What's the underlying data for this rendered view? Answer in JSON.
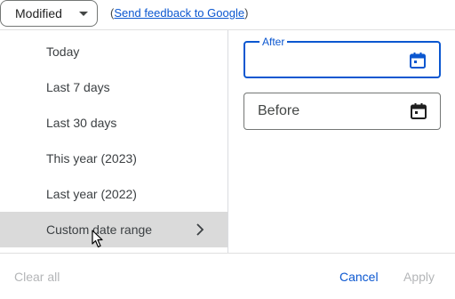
{
  "filter_chip": {
    "label": "Modified",
    "icon": "dropdown-caret-icon"
  },
  "feedback": {
    "open_paren": "(",
    "link_text": "Send feedback to Google",
    "close_paren": ")"
  },
  "menu": {
    "items": [
      {
        "label": "Today"
      },
      {
        "label": "Last 7 days"
      },
      {
        "label": "Last 30 days"
      },
      {
        "label": "This year (2023)"
      },
      {
        "label": "Last year (2022)"
      },
      {
        "label": "Custom date range",
        "selected": true,
        "icon": "chevron-right-icon"
      }
    ]
  },
  "date_range": {
    "after": {
      "label": "After",
      "value": "",
      "icon": "calendar-icon"
    },
    "before": {
      "label": "Before",
      "value": "",
      "icon": "calendar-icon"
    }
  },
  "footer": {
    "clear_all": "Clear all",
    "cancel": "Cancel",
    "apply": "Apply"
  },
  "colors": {
    "accent": "#0b57d0",
    "selected_bg": "#dadada",
    "disabled_text": "#b4b6b8"
  }
}
